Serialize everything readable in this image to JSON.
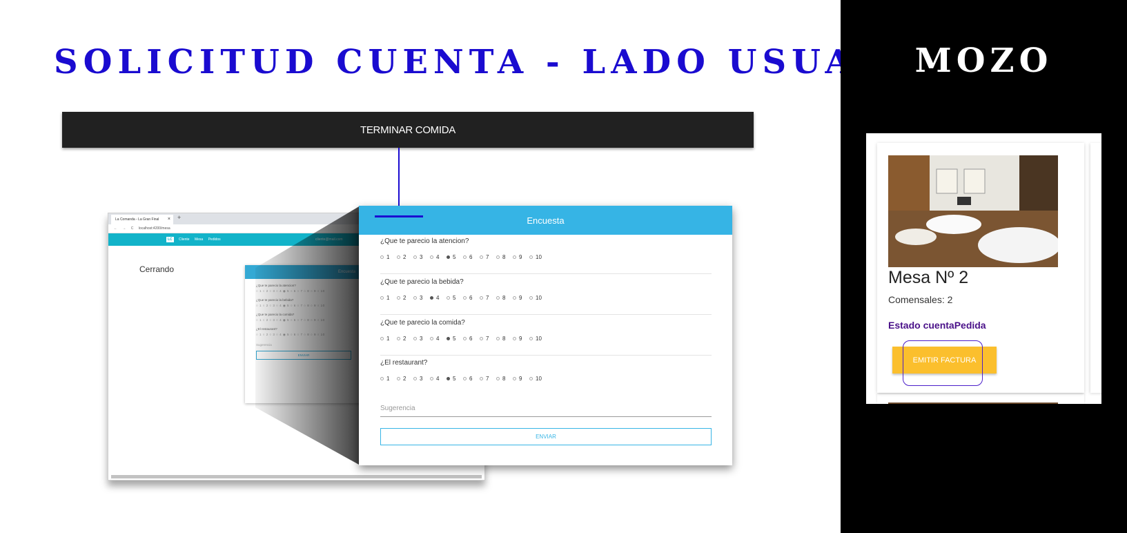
{
  "slide": {
    "title": "SOLICITUD CUENTA -  LADO USUARIO",
    "right_title": "MOZO"
  },
  "top_bar": {
    "label": "TERMINAR COMIDA"
  },
  "browser": {
    "tab_title": "La Comanda - La Gran Final",
    "new_tab": "+",
    "close": "×",
    "address": "localhost:4200/mesa",
    "logo": "LC",
    "nav": [
      "Cliente",
      "Mesa",
      "Pedidos"
    ],
    "user": "cliente@mail.com",
    "closing_text": "Cerrando",
    "mini_title": "Encuesta",
    "mini_questions": [
      "¿Que te parecio la atencion?",
      "¿Que te parecio la bebida?",
      "¿Que te parecio la comida?",
      "¿El restaurant?"
    ],
    "mini_scale": "○ 1 ○ 2 ○ 3 ○ 4 ◉ 5 ○ 6 ○ 7 ○ 8 ○ 9 ○ 10",
    "mini_suggestion": "Sugerencia",
    "mini_send": "ENVIAR"
  },
  "survey": {
    "title": "Encuesta",
    "questions": [
      {
        "label": "¿Que te parecio la atencion?",
        "selected": 5
      },
      {
        "label": "¿Que te parecio la bebida?",
        "selected": 4
      },
      {
        "label": "¿Que te parecio la comida?",
        "selected": 5
      },
      {
        "label": "¿El restaurant?",
        "selected": 5
      }
    ],
    "options": [
      "1",
      "2",
      "3",
      "4",
      "5",
      "6",
      "7",
      "8",
      "9",
      "10"
    ],
    "suggestion_placeholder": "Sugerencia",
    "send_label": "ENVIAR"
  },
  "waiter_card": {
    "table": "Mesa Nº 2",
    "diners": "Comensales: 2",
    "status": "Estado cuentaPedida",
    "button": "EMITIR FACTURA"
  },
  "colors": {
    "title_blue": "#1a0bd0",
    "survey_header": "#36b4e5",
    "button_yellow": "#fbbf2d",
    "status_purple": "#4a1189"
  }
}
